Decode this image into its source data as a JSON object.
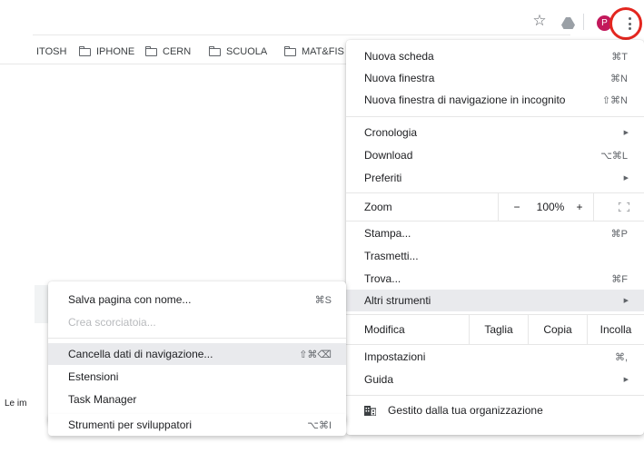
{
  "toolbar": {
    "star_glyph": "☆",
    "avatar_initial": "P"
  },
  "bookmarks": [
    {
      "label": "ITOSH",
      "folder": false
    },
    {
      "label": "IPHONE",
      "folder": true
    },
    {
      "label": "CERN",
      "folder": true
    },
    {
      "label": "SCUOLA",
      "folder": true
    },
    {
      "label": "MAT&FIS",
      "folder": true
    }
  ],
  "page": {
    "text": "Le im"
  },
  "main_menu": {
    "new_tab": {
      "label": "Nuova scheda",
      "shortcut": "⌘T"
    },
    "new_window": {
      "label": "Nuova finestra",
      "shortcut": "⌘N"
    },
    "incognito": {
      "label": "Nuova finestra di navigazione in incognito",
      "shortcut": "⇧⌘N"
    },
    "history": {
      "label": "Cronologia"
    },
    "downloads": {
      "label": "Download",
      "shortcut": "⌥⌘L"
    },
    "bookmarks": {
      "label": "Preferiti"
    },
    "zoom": {
      "label": "Zoom",
      "minus": "−",
      "level": "100%",
      "plus": "+"
    },
    "print": {
      "label": "Stampa...",
      "shortcut": "⌘P"
    },
    "cast": {
      "label": "Trasmetti..."
    },
    "find": {
      "label": "Trova...",
      "shortcut": "⌘F"
    },
    "more_tools": {
      "label": "Altri strumenti"
    },
    "edit": {
      "label": "Modifica",
      "cut": "Taglia",
      "copy": "Copia",
      "paste": "Incolla"
    },
    "settings": {
      "label": "Impostazioni",
      "shortcut": "⌘,"
    },
    "help": {
      "label": "Guida"
    },
    "managed": {
      "label": "Gestito dalla tua organizzazione"
    },
    "submenu_arrow": "▶"
  },
  "sub_menu": {
    "save_page": {
      "label": "Salva pagina con nome...",
      "shortcut": "⌘S"
    },
    "create_shortcut": {
      "label": "Crea scorciatoia..."
    },
    "clear_data": {
      "label": "Cancella dati di navigazione...",
      "shortcut": "⇧⌘⌫"
    },
    "extensions": {
      "label": "Estensioni"
    },
    "task_manager": {
      "label": "Task Manager"
    },
    "dev_tools": {
      "label": "Strumenti per sviluppatori",
      "shortcut": "⌥⌘I"
    }
  },
  "colors": {
    "highlight": "#e9eaed",
    "annotation_circle": "#e3261f"
  }
}
